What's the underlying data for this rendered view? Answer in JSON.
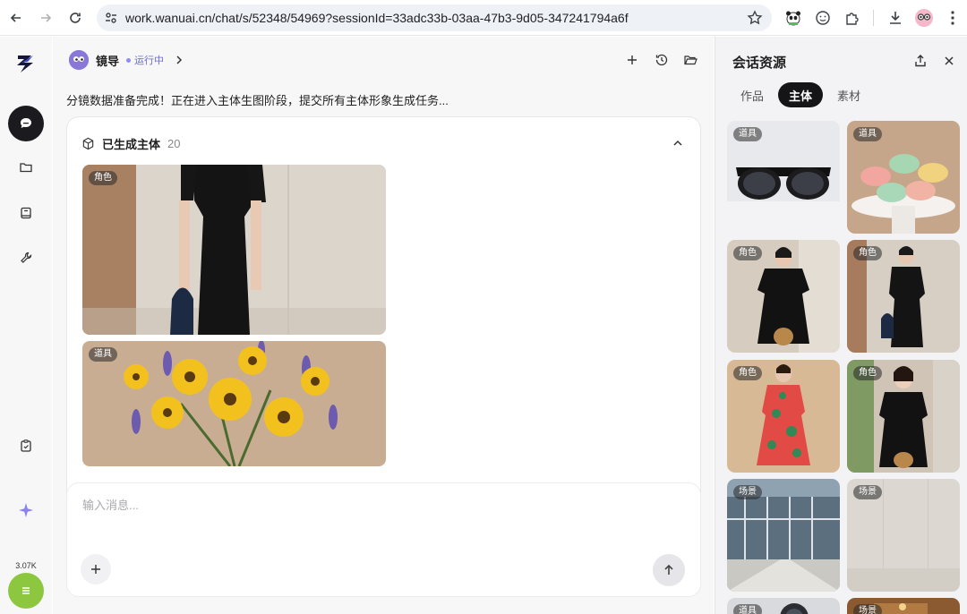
{
  "browser": {
    "url": "work.wanuai.cn/chat/s/52348/54969?sessionId=33adc33b-03aa-47b3-9d05-347241794a6f",
    "back_icon": "arrow-left-icon",
    "forward_icon": "arrow-right-icon",
    "reload_icon": "reload-icon"
  },
  "rail": {
    "credits": "3.07K"
  },
  "agent": {
    "name": "镜导",
    "status": "运行中"
  },
  "message": {
    "text": "分镜数据准备完成！正在进入主体生图阶段，提交所有主体形象生成任务..."
  },
  "card": {
    "title": "已生成主体",
    "count": "20",
    "items": [
      {
        "tag": "角色"
      },
      {
        "tag": "道具"
      }
    ]
  },
  "composer": {
    "placeholder": "输入消息..."
  },
  "panel": {
    "title": "会话资源",
    "tabs": [
      "作品",
      "主体",
      "素材"
    ],
    "active_tab": "主体",
    "grid": [
      {
        "tag": "道具"
      },
      {
        "tag": "道具"
      },
      {
        "tag": "角色"
      },
      {
        "tag": "角色"
      },
      {
        "tag": "角色"
      },
      {
        "tag": "角色"
      },
      {
        "tag": "场景"
      },
      {
        "tag": "场景"
      },
      {
        "tag": "道具"
      },
      {
        "tag": "场景"
      }
    ]
  },
  "colors": {
    "accent": "#6a6ae0",
    "active_nav": "#1b1b1f",
    "menu_fab": "#8dc63f"
  }
}
